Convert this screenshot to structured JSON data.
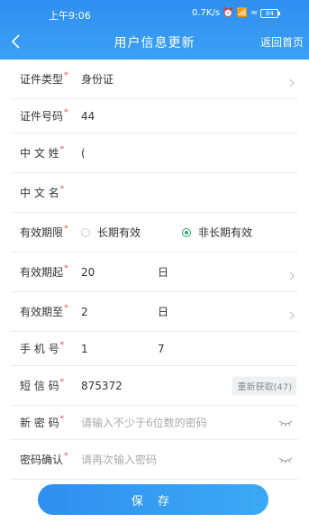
{
  "status_bar": {
    "time": "上午9:06",
    "speed": "0.7K/s",
    "battery": "84"
  },
  "nav": {
    "title": "用户信息更新",
    "home_link": "返回首页"
  },
  "form": {
    "id_type": {
      "label": "证件类型",
      "value": "身份证"
    },
    "id_number": {
      "label": "证件号码",
      "value": "44"
    },
    "surname": {
      "label": "中 文 姓",
      "value": "("
    },
    "given_name": {
      "label": "中 文 名",
      "value": ""
    },
    "validity": {
      "label": "有效期限",
      "option_long": "长期有效",
      "option_not_long": "非长期有效",
      "selected": "非长期有效"
    },
    "valid_from": {
      "label": "有效期起",
      "value": "20",
      "unit": "日"
    },
    "valid_to": {
      "label": "有效期至",
      "value": "2",
      "unit": "日"
    },
    "phone": {
      "label": "手 机 号",
      "value": "1",
      "value_tail": "7"
    },
    "sms_code": {
      "label": "短 信 码",
      "value": "875372",
      "resend": "重新获取(47)"
    },
    "new_password": {
      "label": "新 密 码",
      "placeholder": "请输入不少于6位数的密码"
    },
    "confirm_password": {
      "label": "密码确认",
      "placeholder": "请再次输入密码"
    }
  },
  "save_button": "保 存",
  "colors": {
    "primary": "#2f8ff0",
    "radio_checked": "#35a86a",
    "required_star": "#e44444"
  }
}
